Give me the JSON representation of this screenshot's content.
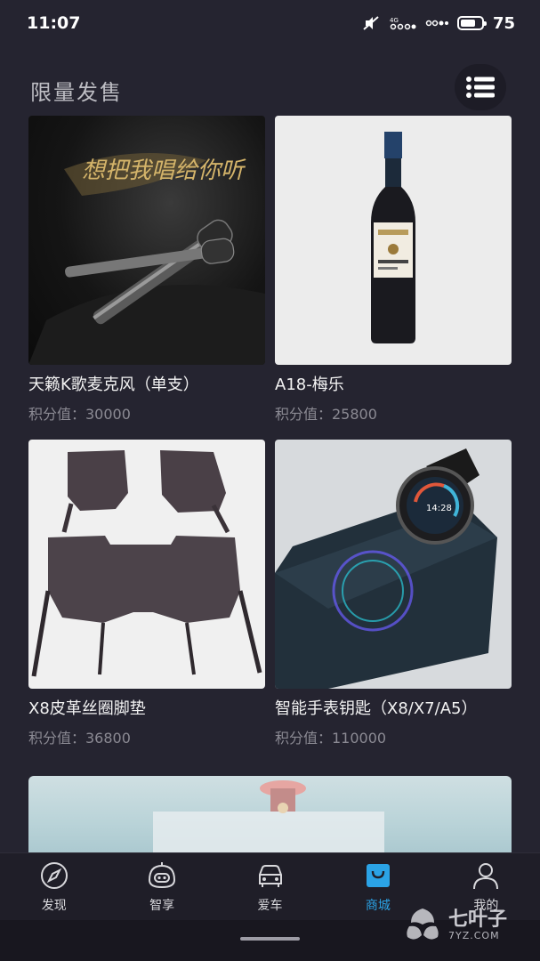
{
  "status_bar": {
    "time": "11:07",
    "battery_level": "75",
    "icons": [
      "silent-icon",
      "signal-icon",
      "wifi-icon",
      "battery-icon"
    ]
  },
  "page": {
    "section_title": "限量发售",
    "menu_icon": "list-icon"
  },
  "products": [
    {
      "name": "天籁K歌麦克风（单支）",
      "points": "积分值：30000",
      "image": "microphone"
    },
    {
      "name": "A18-梅乐",
      "points": "积分值：25800",
      "image": "wine-bottle"
    },
    {
      "name": "X8皮革丝圈脚垫",
      "points": "积分值：36800",
      "image": "car-floor-mats"
    },
    {
      "name": "智能手表钥匙（X8/X7/A5）",
      "points": "积分值：110000",
      "image": "smartwatch"
    }
  ],
  "tab_bar": {
    "tabs": [
      {
        "label": "发现",
        "icon": "compass-icon"
      },
      {
        "label": "智享",
        "icon": "robot-icon"
      },
      {
        "label": "爱车",
        "icon": "car-icon"
      },
      {
        "label": "商城",
        "icon": "shopping-bag-icon"
      },
      {
        "label": "我的",
        "icon": "user-icon"
      }
    ],
    "active_index": 3
  },
  "watermark": {
    "main": "七叶子",
    "sub": "7YZ.COM"
  },
  "colors": {
    "background": "#252430",
    "accent": "#2ba3e6",
    "secondary_text": "#8b8a93"
  }
}
